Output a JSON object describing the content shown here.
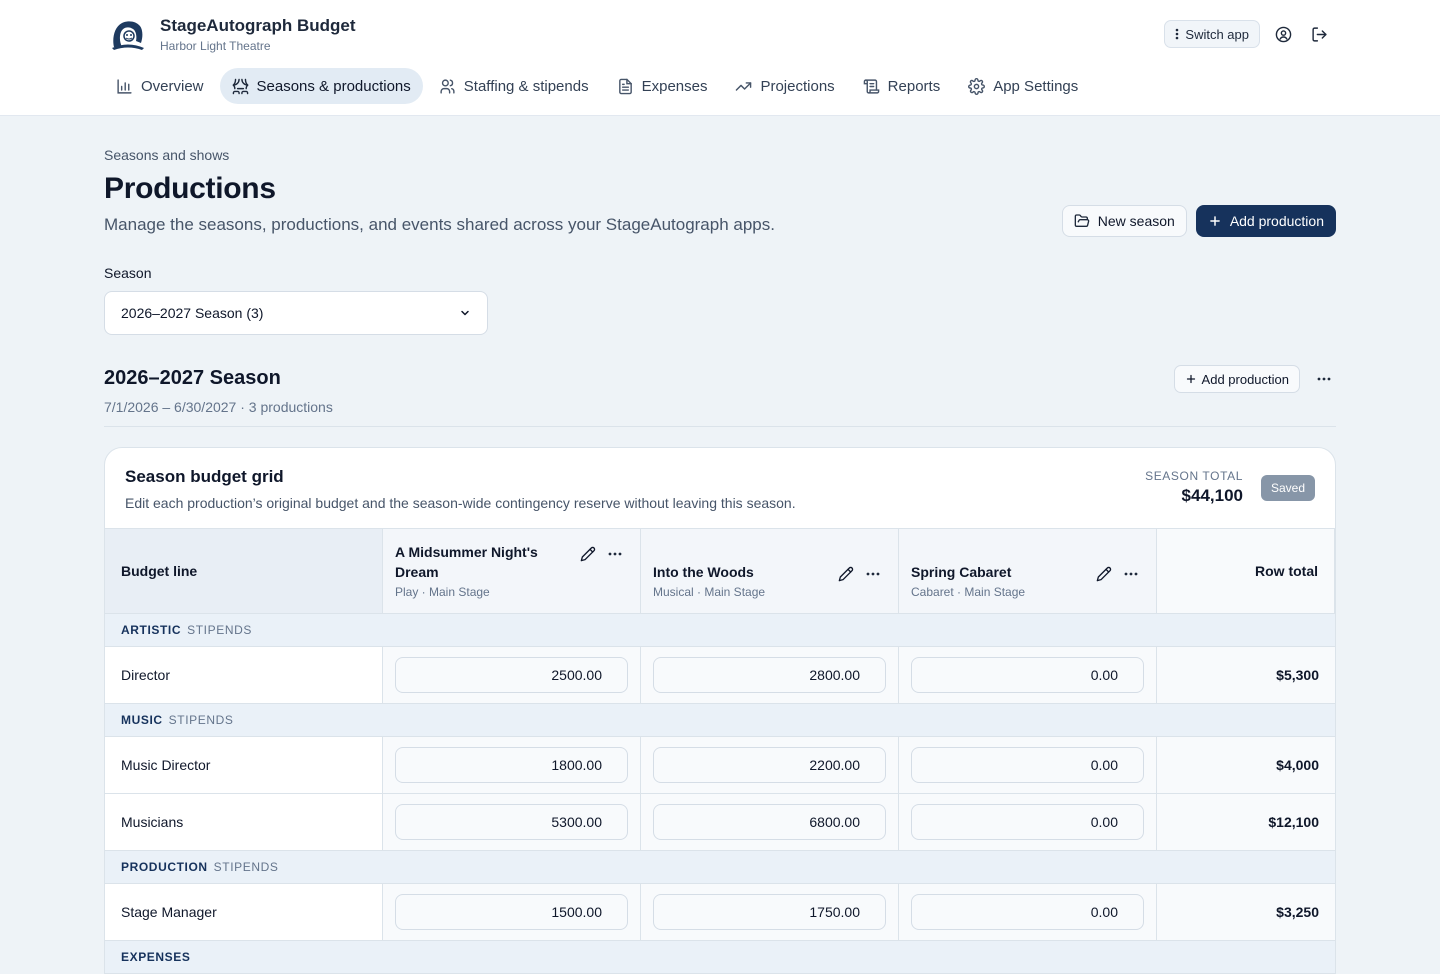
{
  "app": {
    "title": "StageAutograph Budget",
    "subtitle": "Harbor Light Theatre",
    "switch_label": "Switch app"
  },
  "nav": [
    {
      "label": "Overview",
      "icon": "bar-chart-icon",
      "active": false
    },
    {
      "label": "Seasons & productions",
      "icon": "theater-masks-icon",
      "active": true
    },
    {
      "label": "Staffing & stipends",
      "icon": "users-icon",
      "active": false
    },
    {
      "label": "Expenses",
      "icon": "receipt-icon",
      "active": false
    },
    {
      "label": "Projections",
      "icon": "trending-up-icon",
      "active": false
    },
    {
      "label": "Reports",
      "icon": "scroll-icon",
      "active": false
    },
    {
      "label": "App Settings",
      "icon": "gear-icon",
      "active": false
    }
  ],
  "page": {
    "breadcrumb": "Seasons and shows",
    "title": "Productions",
    "description": "Manage the seasons, productions, and events shared across your StageAutograph apps.",
    "new_season_label": "New season",
    "add_production_label": "Add production",
    "season_label": "Season",
    "season_selected": "2026–2027 Season (3)"
  },
  "season": {
    "title": "2026–2027 Season",
    "meta": "7/1/2026 – 6/30/2027 · 3 productions",
    "add_production_label": "Add production"
  },
  "grid": {
    "title": "Season budget grid",
    "description": "Edit each production’s original budget and the season-wide contingency reserve without leaving this season.",
    "total_label": "SEASON TOTAL",
    "total_value": "$44,100",
    "saved_label": "Saved",
    "budget_line_header": "Budget line",
    "row_total_header": "Row total",
    "productions": [
      {
        "name": "A Midsummer Night's Dream",
        "meta": "Play · Main Stage"
      },
      {
        "name": "Into the Woods",
        "meta": "Musical · Main Stage"
      },
      {
        "name": "Spring Cabaret",
        "meta": "Cabaret · Main Stage"
      }
    ],
    "groups": [
      {
        "name": "ARTISTIC",
        "sub": "STIPENDS",
        "rows": [
          {
            "label": "Director",
            "values": [
              "2500.00",
              "2800.00",
              "0.00"
            ],
            "total": "$5,300"
          }
        ]
      },
      {
        "name": "MUSIC",
        "sub": "STIPENDS",
        "rows": [
          {
            "label": "Music Director",
            "values": [
              "1800.00",
              "2200.00",
              "0.00"
            ],
            "total": "$4,000"
          },
          {
            "label": "Musicians",
            "values": [
              "5300.00",
              "6800.00",
              "0.00"
            ],
            "total": "$12,100"
          }
        ]
      },
      {
        "name": "PRODUCTION",
        "sub": "STIPENDS",
        "rows": [
          {
            "label": "Stage Manager",
            "values": [
              "1500.00",
              "1750.00",
              "0.00"
            ],
            "total": "$3,250"
          }
        ]
      },
      {
        "name": "EXPENSES",
        "sub": "",
        "rows": []
      }
    ]
  }
}
